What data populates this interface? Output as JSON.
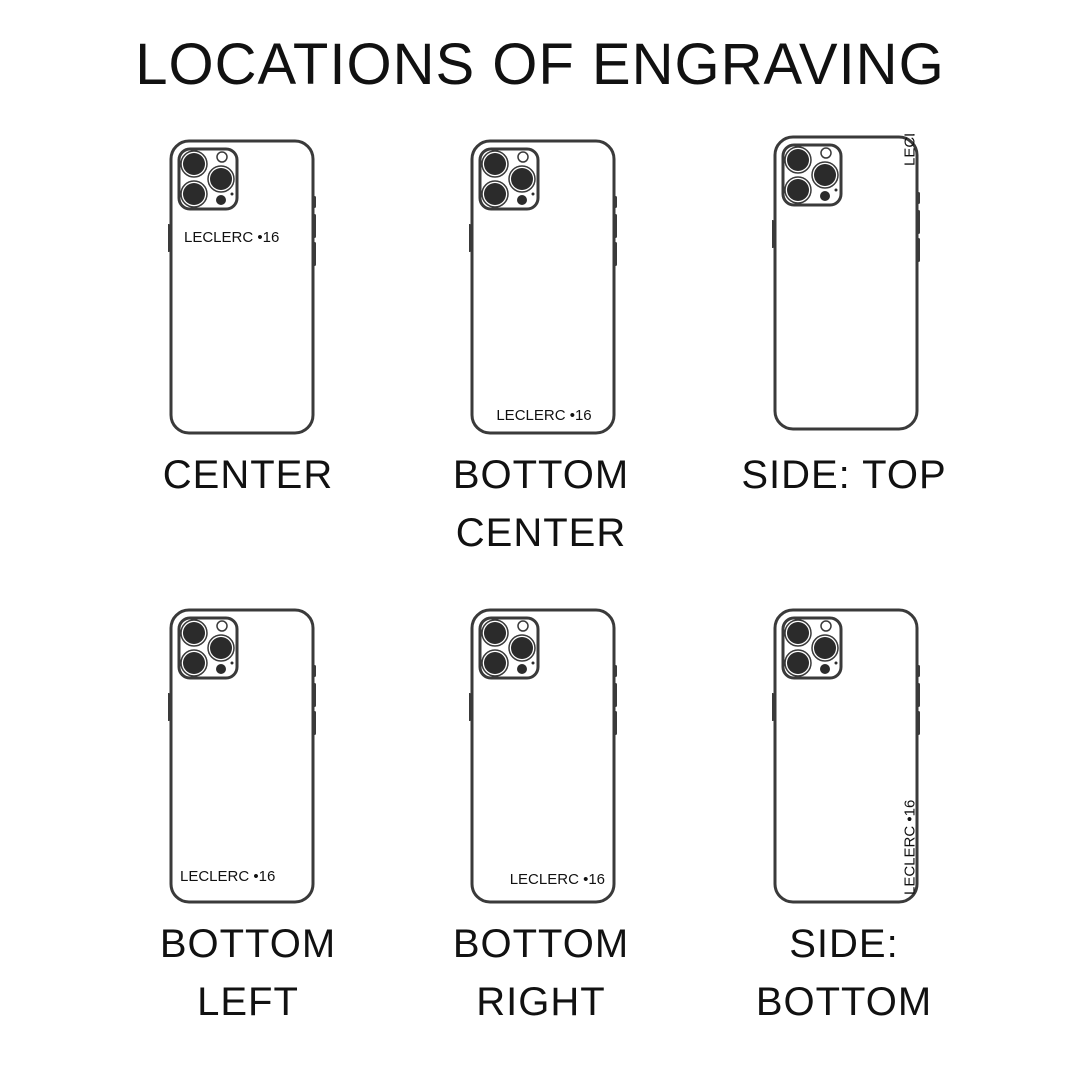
{
  "title": "LOCATIONS OF ENGRAVING",
  "engraving_text": "LECLERC •16",
  "options": [
    {
      "label_lines": [
        "CENTER"
      ],
      "position": "center"
    },
    {
      "label_lines": [
        "BOTTOM",
        "CENTER"
      ],
      "position": "bottom-center"
    },
    {
      "label_lines": [
        "SIDE: TOP"
      ],
      "position": "side-top"
    },
    {
      "label_lines": [
        "BOTTOM",
        "LEFT"
      ],
      "position": "bottom-left"
    },
    {
      "label_lines": [
        "BOTTOM",
        "RIGHT"
      ],
      "position": "bottom-right"
    },
    {
      "label_lines": [
        "SIDE:",
        "BOTTOM"
      ],
      "position": "side-bottom"
    }
  ],
  "colors": {
    "outline": "#3a3a3a",
    "lens": "#2b2b2b",
    "text": "#111111",
    "background": "#ffffff"
  }
}
